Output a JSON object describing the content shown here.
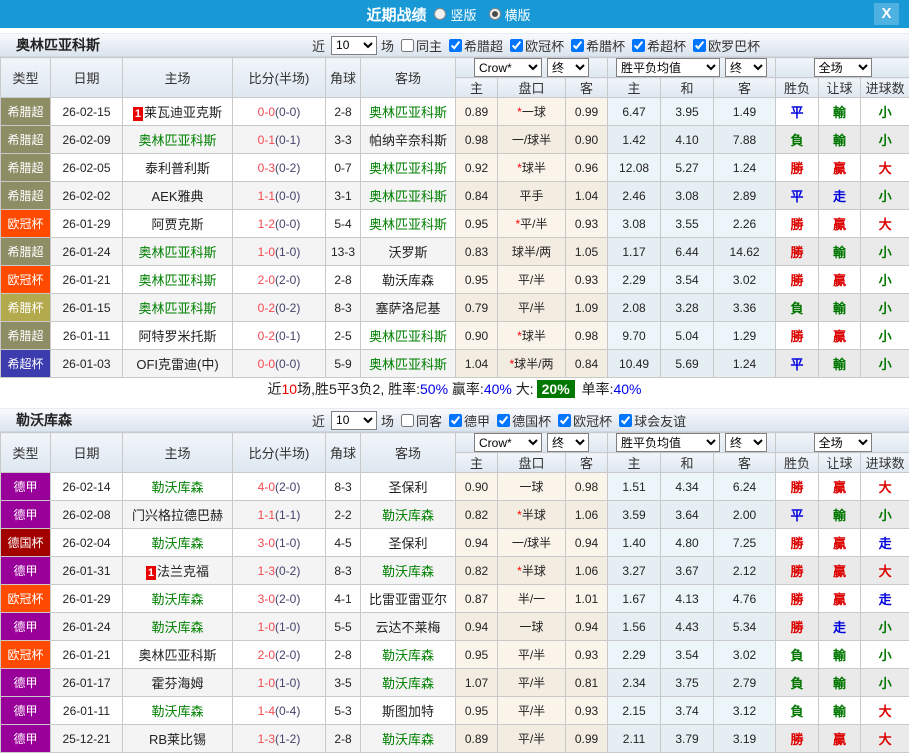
{
  "topbar": {
    "title": "近期战绩",
    "vertical_label": "竖版",
    "horizontal_label": "横版",
    "selected_layout": "横版",
    "close_glyph": "X",
    "bar_color": "#1899d5"
  },
  "columns": {
    "main": [
      "类型",
      "日期",
      "主场",
      "比分(半场)",
      "角球",
      "客场"
    ],
    "sub": [
      "主",
      "盘口",
      "客",
      "主",
      "和",
      "客",
      "胜负",
      "让球",
      "进球数"
    ]
  },
  "league_colors": {
    "希腊超": "#8d8d66",
    "欧冠杯": "#ff4a00",
    "希腊杯": "#b3aa4d",
    "希超杯": "#3c3cae",
    "德甲": "#990099",
    "德国杯": "#a30000"
  },
  "sections": [
    {
      "team": "奥林匹亚科斯",
      "filters": {
        "near": "近",
        "count": "10",
        "games": "场",
        "same": "同主",
        "leagues": [
          "希腊超",
          "欧冠杯",
          "希腊杯",
          "希超杯",
          "欧罗巴杯"
        ]
      },
      "selectors": {
        "company": "Crow*",
        "time": "终",
        "wdl": "胜平负均值",
        "wdl_time": "终",
        "scope": "全场"
      },
      "rows": [
        {
          "type": "希腊超",
          "type_color": "#8d8d66",
          "date": "26-02-15",
          "home": "莱瓦迪亚克斯",
          "home_badge": "1",
          "home_focus": false,
          "ft": "0-0",
          "ht": "(0-0)",
          "corners": "2-8",
          "away": "奥林匹亚科斯",
          "away_focus": true,
          "home_odds": "0.89",
          "handicap": "一球",
          "handicap_star": true,
          "away_odds": "0.99",
          "win": "6.47",
          "draw": "3.95",
          "lose": "1.49",
          "res_wdl": {
            "t": "平",
            "c": "blue"
          },
          "res_handicap": {
            "t": "輸",
            "c": "green"
          },
          "res_goals": {
            "t": "小",
            "c": "green"
          }
        },
        {
          "type": "希腊超",
          "type_color": "#8d8d66",
          "date": "26-02-09",
          "home": "奥林匹亚科斯",
          "home_badge": "",
          "home_focus": true,
          "ft": "0-1",
          "ht": "(0-1)",
          "corners": "3-3",
          "away": "帕纳辛奈科斯",
          "away_focus": false,
          "home_odds": "0.98",
          "handicap": "一/球半",
          "handicap_star": false,
          "away_odds": "0.90",
          "win": "1.42",
          "draw": "4.10",
          "lose": "7.88",
          "res_wdl": {
            "t": "負",
            "c": "green"
          },
          "res_handicap": {
            "t": "輸",
            "c": "green"
          },
          "res_goals": {
            "t": "小",
            "c": "green"
          }
        },
        {
          "type": "希腊超",
          "type_color": "#8d8d66",
          "date": "26-02-05",
          "home": "泰利普利斯",
          "home_badge": "",
          "home_focus": false,
          "ft": "0-3",
          "ht": "(0-2)",
          "corners": "0-7",
          "away": "奥林匹亚科斯",
          "away_focus": true,
          "home_odds": "0.92",
          "handicap": "球半",
          "handicap_star": true,
          "away_odds": "0.96",
          "win": "12.08",
          "draw": "5.27",
          "lose": "1.24",
          "res_wdl": {
            "t": "勝",
            "c": "red"
          },
          "res_handicap": {
            "t": "贏",
            "c": "red"
          },
          "res_goals": {
            "t": "大",
            "c": "red"
          }
        },
        {
          "type": "希腊超",
          "type_color": "#8d8d66",
          "date": "26-02-02",
          "home": "AEK雅典",
          "home_badge": "",
          "home_focus": false,
          "ft": "1-1",
          "ht": "(0-0)",
          "corners": "3-1",
          "away": "奥林匹亚科斯",
          "away_focus": true,
          "home_odds": "0.84",
          "handicap": "平手",
          "handicap_star": false,
          "away_odds": "1.04",
          "win": "2.46",
          "draw": "3.08",
          "lose": "2.89",
          "res_wdl": {
            "t": "平",
            "c": "blue"
          },
          "res_handicap": {
            "t": "走",
            "c": "blue"
          },
          "res_goals": {
            "t": "小",
            "c": "green"
          }
        },
        {
          "type": "欧冠杯",
          "type_color": "#ff4a00",
          "date": "26-01-29",
          "home": "阿贾克斯",
          "home_badge": "",
          "home_focus": false,
          "ft": "1-2",
          "ht": "(0-0)",
          "corners": "5-4",
          "away": "奥林匹亚科斯",
          "away_focus": true,
          "home_odds": "0.95",
          "handicap": "平/半",
          "handicap_star": true,
          "away_odds": "0.93",
          "win": "3.08",
          "draw": "3.55",
          "lose": "2.26",
          "res_wdl": {
            "t": "勝",
            "c": "red"
          },
          "res_handicap": {
            "t": "贏",
            "c": "red"
          },
          "res_goals": {
            "t": "大",
            "c": "red"
          }
        },
        {
          "type": "希腊超",
          "type_color": "#8d8d66",
          "date": "26-01-24",
          "home": "奥林匹亚科斯",
          "home_badge": "",
          "home_focus": true,
          "ft": "1-0",
          "ht": "(1-0)",
          "corners": "13-3",
          "away": "沃罗斯",
          "away_focus": false,
          "home_odds": "0.83",
          "handicap": "球半/两",
          "handicap_star": false,
          "away_odds": "1.05",
          "win": "1.17",
          "draw": "6.44",
          "lose": "14.62",
          "res_wdl": {
            "t": "勝",
            "c": "red"
          },
          "res_handicap": {
            "t": "輸",
            "c": "green"
          },
          "res_goals": {
            "t": "小",
            "c": "green"
          }
        },
        {
          "type": "欧冠杯",
          "type_color": "#ff4a00",
          "date": "26-01-21",
          "home": "奥林匹亚科斯",
          "home_badge": "",
          "home_focus": true,
          "ft": "2-0",
          "ht": "(2-0)",
          "corners": "2-8",
          "away": "勒沃库森",
          "away_focus": false,
          "home_odds": "0.95",
          "handicap": "平/半",
          "handicap_star": false,
          "away_odds": "0.93",
          "win": "2.29",
          "draw": "3.54",
          "lose": "3.02",
          "res_wdl": {
            "t": "勝",
            "c": "red"
          },
          "res_handicap": {
            "t": "贏",
            "c": "red"
          },
          "res_goals": {
            "t": "小",
            "c": "green"
          }
        },
        {
          "type": "希腊杯",
          "type_color": "#b3aa4d",
          "date": "26-01-15",
          "home": "奥林匹亚科斯",
          "home_badge": "",
          "home_focus": true,
          "ft": "0-2",
          "ht": "(0-2)",
          "corners": "8-3",
          "away": "塞萨洛尼基",
          "away_focus": false,
          "home_odds": "0.79",
          "handicap": "平/半",
          "handicap_star": false,
          "away_odds": "1.09",
          "win": "2.08",
          "draw": "3.28",
          "lose": "3.36",
          "res_wdl": {
            "t": "負",
            "c": "green"
          },
          "res_handicap": {
            "t": "輸",
            "c": "green"
          },
          "res_goals": {
            "t": "小",
            "c": "green"
          }
        },
        {
          "type": "希腊超",
          "type_color": "#8d8d66",
          "date": "26-01-11",
          "home": "阿特罗米托斯",
          "home_badge": "",
          "home_focus": false,
          "ft": "0-2",
          "ht": "(0-1)",
          "corners": "2-5",
          "away": "奥林匹亚科斯",
          "away_focus": true,
          "home_odds": "0.90",
          "handicap": "球半",
          "handicap_star": true,
          "away_odds": "0.98",
          "win": "9.70",
          "draw": "5.04",
          "lose": "1.29",
          "res_wdl": {
            "t": "勝",
            "c": "red"
          },
          "res_handicap": {
            "t": "贏",
            "c": "red"
          },
          "res_goals": {
            "t": "小",
            "c": "green"
          }
        },
        {
          "type": "希超杯",
          "type_color": "#3c3cae",
          "date": "26-01-03",
          "home": "OFI克雷迪(中)",
          "home_badge": "",
          "home_focus": false,
          "ft": "0-0",
          "ht": "(0-0)",
          "corners": "5-9",
          "away": "奥林匹亚科斯",
          "away_focus": true,
          "home_odds": "1.04",
          "handicap": "球半/两",
          "handicap_star": true,
          "away_odds": "0.84",
          "win": "10.49",
          "draw": "5.69",
          "lose": "1.24",
          "res_wdl": {
            "t": "平",
            "c": "blue"
          },
          "res_handicap": {
            "t": "輸",
            "c": "green"
          },
          "res_goals": {
            "t": "小",
            "c": "green"
          }
        }
      ],
      "summary": [
        {
          "t": "近"
        },
        {
          "t": "10",
          "c": "red"
        },
        {
          "t": "场,胜5平3负2, 胜率:"
        },
        {
          "t": "50%",
          "c": "blue"
        },
        {
          "t": " 赢率:"
        },
        {
          "t": "40%",
          "c": "blue"
        },
        {
          "t": " 大:"
        },
        {
          "t": "20%",
          "c": "green"
        },
        {
          "t": " 单率:"
        },
        {
          "t": "40%",
          "c": "blue"
        }
      ]
    },
    {
      "team": "勒沃库森",
      "filters": {
        "near": "近",
        "count": "10",
        "games": "场",
        "same": "同客",
        "leagues": [
          "德甲",
          "德国杯",
          "欧冠杯",
          "球会友谊"
        ]
      },
      "selectors": {
        "company": "Crow*",
        "time": "终",
        "wdl": "胜平负均值",
        "wdl_time": "终",
        "scope": "全场"
      },
      "rows": [
        {
          "type": "德甲",
          "type_color": "#990099",
          "date": "26-02-14",
          "home": "勒沃库森",
          "home_badge": "",
          "home_focus": true,
          "ft": "4-0",
          "ht": "(2-0)",
          "corners": "8-3",
          "away": "圣保利",
          "away_focus": false,
          "home_odds": "0.90",
          "handicap": "一球",
          "handicap_star": false,
          "away_odds": "0.98",
          "win": "1.51",
          "draw": "4.34",
          "lose": "6.24",
          "res_wdl": {
            "t": "勝",
            "c": "red"
          },
          "res_handicap": {
            "t": "贏",
            "c": "red"
          },
          "res_goals": {
            "t": "大",
            "c": "red"
          }
        },
        {
          "type": "德甲",
          "type_color": "#990099",
          "date": "26-02-08",
          "home": "门兴格拉德巴赫",
          "home_badge": "",
          "home_focus": false,
          "ft": "1-1",
          "ht": "(1-1)",
          "corners": "2-2",
          "away": "勒沃库森",
          "away_focus": true,
          "home_odds": "0.82",
          "handicap": "半球",
          "handicap_star": true,
          "away_odds": "1.06",
          "win": "3.59",
          "draw": "3.64",
          "lose": "2.00",
          "res_wdl": {
            "t": "平",
            "c": "blue"
          },
          "res_handicap": {
            "t": "輸",
            "c": "green"
          },
          "res_goals": {
            "t": "小",
            "c": "green"
          }
        },
        {
          "type": "德国杯",
          "type_color": "#a30000",
          "date": "26-02-04",
          "home": "勒沃库森",
          "home_badge": "",
          "home_focus": true,
          "ft": "3-0",
          "ht": "(1-0)",
          "corners": "4-5",
          "away": "圣保利",
          "away_focus": false,
          "home_odds": "0.94",
          "handicap": "一/球半",
          "handicap_star": false,
          "away_odds": "0.94",
          "win": "1.40",
          "draw": "4.80",
          "lose": "7.25",
          "res_wdl": {
            "t": "勝",
            "c": "red"
          },
          "res_handicap": {
            "t": "贏",
            "c": "red"
          },
          "res_goals": {
            "t": "走",
            "c": "blue"
          }
        },
        {
          "type": "德甲",
          "type_color": "#990099",
          "date": "26-01-31",
          "home": "法兰克福",
          "home_badge": "1",
          "home_focus": false,
          "ft": "1-3",
          "ht": "(0-2)",
          "corners": "8-3",
          "away": "勒沃库森",
          "away_focus": true,
          "home_odds": "0.82",
          "handicap": "半球",
          "handicap_star": true,
          "away_odds": "1.06",
          "win": "3.27",
          "draw": "3.67",
          "lose": "2.12",
          "res_wdl": {
            "t": "勝",
            "c": "red"
          },
          "res_handicap": {
            "t": "贏",
            "c": "red"
          },
          "res_goals": {
            "t": "大",
            "c": "red"
          }
        },
        {
          "type": "欧冠杯",
          "type_color": "#ff4a00",
          "date": "26-01-29",
          "home": "勒沃库森",
          "home_badge": "",
          "home_focus": true,
          "ft": "3-0",
          "ht": "(2-0)",
          "corners": "4-1",
          "away": "比雷亚雷亚尔",
          "away_focus": false,
          "home_odds": "0.87",
          "handicap": "半/一",
          "handicap_star": false,
          "away_odds": "1.01",
          "win": "1.67",
          "draw": "4.13",
          "lose": "4.76",
          "res_wdl": {
            "t": "勝",
            "c": "red"
          },
          "res_handicap": {
            "t": "贏",
            "c": "red"
          },
          "res_goals": {
            "t": "走",
            "c": "blue"
          }
        },
        {
          "type": "德甲",
          "type_color": "#990099",
          "date": "26-01-24",
          "home": "勒沃库森",
          "home_badge": "",
          "home_focus": true,
          "ft": "1-0",
          "ht": "(1-0)",
          "corners": "5-5",
          "away": "云达不莱梅",
          "away_focus": false,
          "home_odds": "0.94",
          "handicap": "一球",
          "handicap_star": false,
          "away_odds": "0.94",
          "win": "1.56",
          "draw": "4.43",
          "lose": "5.34",
          "res_wdl": {
            "t": "勝",
            "c": "red"
          },
          "res_handicap": {
            "t": "走",
            "c": "blue"
          },
          "res_goals": {
            "t": "小",
            "c": "green"
          }
        },
        {
          "type": "欧冠杯",
          "type_color": "#ff4a00",
          "date": "26-01-21",
          "home": "奥林匹亚科斯",
          "home_badge": "",
          "home_focus": false,
          "ft": "2-0",
          "ht": "(2-0)",
          "corners": "2-8",
          "away": "勒沃库森",
          "away_focus": true,
          "home_odds": "0.95",
          "handicap": "平/半",
          "handicap_star": false,
          "away_odds": "0.93",
          "win": "2.29",
          "draw": "3.54",
          "lose": "3.02",
          "res_wdl": {
            "t": "負",
            "c": "green"
          },
          "res_handicap": {
            "t": "輸",
            "c": "green"
          },
          "res_goals": {
            "t": "小",
            "c": "green"
          }
        },
        {
          "type": "德甲",
          "type_color": "#990099",
          "date": "26-01-17",
          "home": "霍芬海姆",
          "home_badge": "",
          "home_focus": false,
          "ft": "1-0",
          "ht": "(1-0)",
          "corners": "3-5",
          "away": "勒沃库森",
          "away_focus": true,
          "home_odds": "1.07",
          "handicap": "平/半",
          "handicap_star": false,
          "away_odds": "0.81",
          "win": "2.34",
          "draw": "3.75",
          "lose": "2.79",
          "res_wdl": {
            "t": "負",
            "c": "green"
          },
          "res_handicap": {
            "t": "輸",
            "c": "green"
          },
          "res_goals": {
            "t": "小",
            "c": "green"
          }
        },
        {
          "type": "德甲",
          "type_color": "#990099",
          "date": "26-01-11",
          "home": "勒沃库森",
          "home_badge": "",
          "home_focus": true,
          "ft": "1-4",
          "ht": "(0-4)",
          "corners": "5-3",
          "away": "斯图加特",
          "away_focus": false,
          "home_odds": "0.95",
          "handicap": "平/半",
          "handicap_star": false,
          "away_odds": "0.93",
          "win": "2.15",
          "draw": "3.74",
          "lose": "3.12",
          "res_wdl": {
            "t": "負",
            "c": "green"
          },
          "res_handicap": {
            "t": "輸",
            "c": "green"
          },
          "res_goals": {
            "t": "大",
            "c": "red"
          }
        },
        {
          "type": "德甲",
          "type_color": "#990099",
          "date": "25-12-21",
          "home": "RB莱比锡",
          "home_badge": "",
          "home_focus": false,
          "ft": "1-3",
          "ht": "(1-2)",
          "corners": "2-8",
          "away": "勒沃库森",
          "away_focus": true,
          "home_odds": "0.89",
          "handicap": "平/半",
          "handicap_star": false,
          "away_odds": "0.99",
          "win": "2.11",
          "draw": "3.79",
          "lose": "3.19",
          "res_wdl": {
            "t": "勝",
            "c": "red"
          },
          "res_handicap": {
            "t": "贏",
            "c": "red"
          },
          "res_goals": {
            "t": "大",
            "c": "red"
          }
        }
      ],
      "summary": null
    }
  ]
}
